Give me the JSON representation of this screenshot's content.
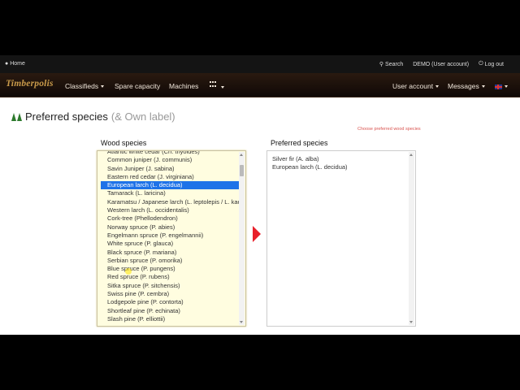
{
  "topbar": {
    "home_label": "Home",
    "search_label": "Search",
    "account_label": "DEMO (User account)",
    "logout_label": "Log out"
  },
  "navbar": {
    "brand": "Timberpolis",
    "classifieds": "Classifieds",
    "spare_capacity": "Spare capacity",
    "machines": "Machines",
    "user_account": "User account",
    "messages": "Messages"
  },
  "page": {
    "title": "Preferred species",
    "subtitle": "(& Own label)",
    "hint": "Choose preferred wood species",
    "wood_label": "Wood species",
    "preferred_label": "Preferred species"
  },
  "wood_species": [
    "Atlantic white cedar (Ch. thyoides)",
    "Common juniper (J. communis)",
    "Savin Juniper (J. sabina)",
    "Eastern red cedar (J. virginiana)",
    "European larch (L. decidua)",
    "Tamarack (L. laricina)",
    "Karamatsu / Japanese larch (L. leptolepis / L. kaempferi)",
    "Western larch (L. occidentalis)",
    "Cork-tree (Phellodendron)",
    "Norway spruce (P. abies)",
    "Engelmann spruce (P. engelmannii)",
    "White spruce (P. glauca)",
    "Black spruce (P. mariana)",
    "Serbian spruce (P. omorika)",
    "Blue spruce (P. pungens)",
    "Red spruce (P. rubens)",
    "Sitka spruce (P. sitchensis)",
    "Swiss pine (P. cembra)",
    "Lodgepole pine (P. contorta)",
    "Shortleaf pine (P. echinata)",
    "Slash pine (P. elliottii)"
  ],
  "selected_species": "European larch (L. decidua)",
  "preferred_species": [
    "Silver fir (A. alba)",
    "European larch (L. decidua)"
  ],
  "colors": {
    "brand": "#c99a4a",
    "selection": "#1e73e8",
    "arrow": "#e8202a",
    "hint": "#d9534f"
  }
}
